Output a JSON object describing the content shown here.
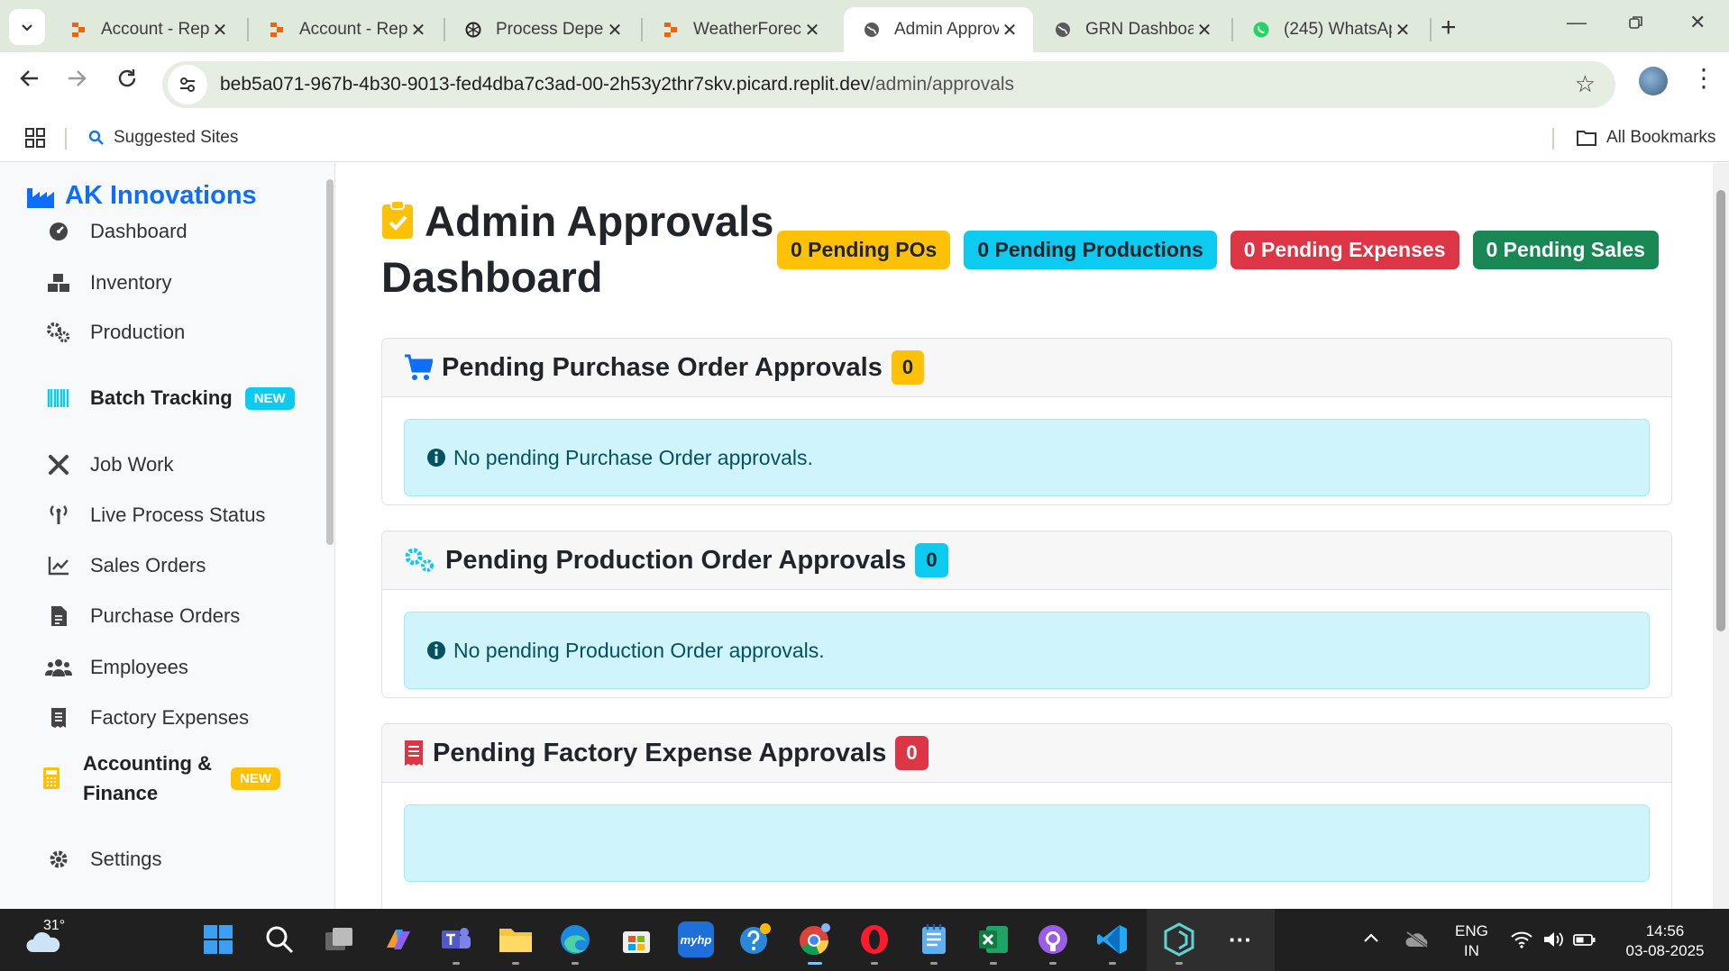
{
  "browser": {
    "tabs": [
      {
        "title": "Account - Rep",
        "icon": "replit-icon"
      },
      {
        "title": "Account - Rep",
        "icon": "replit-icon"
      },
      {
        "title": "Process Deper",
        "icon": "openai-icon"
      },
      {
        "title": "WeatherForec",
        "icon": "replit-icon"
      },
      {
        "title": "Admin Approv",
        "icon": "globe-icon"
      },
      {
        "title": "GRN Dashboa",
        "icon": "globe-icon"
      },
      {
        "title": "(245) WhatsAp",
        "icon": "whatsapp-icon"
      }
    ],
    "url_host": "beb5a071-967b-4b30-9013-fed4dba7c3ad-00-2h53y2thr7skv.picard.replit.dev",
    "url_path": "/admin/approvals",
    "bookmarks": {
      "suggested": "Suggested Sites",
      "all": "All Bookmarks"
    }
  },
  "sidebar": {
    "brand": "AK Innovations",
    "items": [
      {
        "label": "Dashboard"
      },
      {
        "label": "Inventory"
      },
      {
        "label": "Production"
      },
      {
        "label": "Batch Tracking",
        "badge": "NEW"
      },
      {
        "label": "Job Work"
      },
      {
        "label": "Live Process Status"
      },
      {
        "label": "Sales Orders"
      },
      {
        "label": "Purchase Orders"
      },
      {
        "label": "Employees"
      },
      {
        "label": "Factory Expenses"
      },
      {
        "label": "Accounting & Finance",
        "badge": "NEW"
      },
      {
        "label": "Settings"
      }
    ]
  },
  "main": {
    "title": "Admin Approvals Dashboard",
    "pills": [
      {
        "label": "0 Pending POs",
        "color": "#ffc107"
      },
      {
        "label": "0 Pending Productions",
        "color": "#0dcaf0"
      },
      {
        "label": "0 Pending Expenses",
        "color": "#dc3545"
      },
      {
        "label": "0 Pending Sales",
        "color": "#198754"
      }
    ],
    "sections": [
      {
        "title": "Pending Purchase Order Approvals",
        "count": "0",
        "message": "No pending Purchase Order approvals."
      },
      {
        "title": "Pending Production Order Approvals",
        "count": "0",
        "message": "No pending Production Order approvals."
      },
      {
        "title": "Pending Factory Expense Approvals",
        "count": "0"
      }
    ]
  },
  "taskbar": {
    "temperature": "31°",
    "lang_line1": "ENG",
    "lang_line2": "IN",
    "time": "14:56",
    "date": "03-08-2025"
  }
}
